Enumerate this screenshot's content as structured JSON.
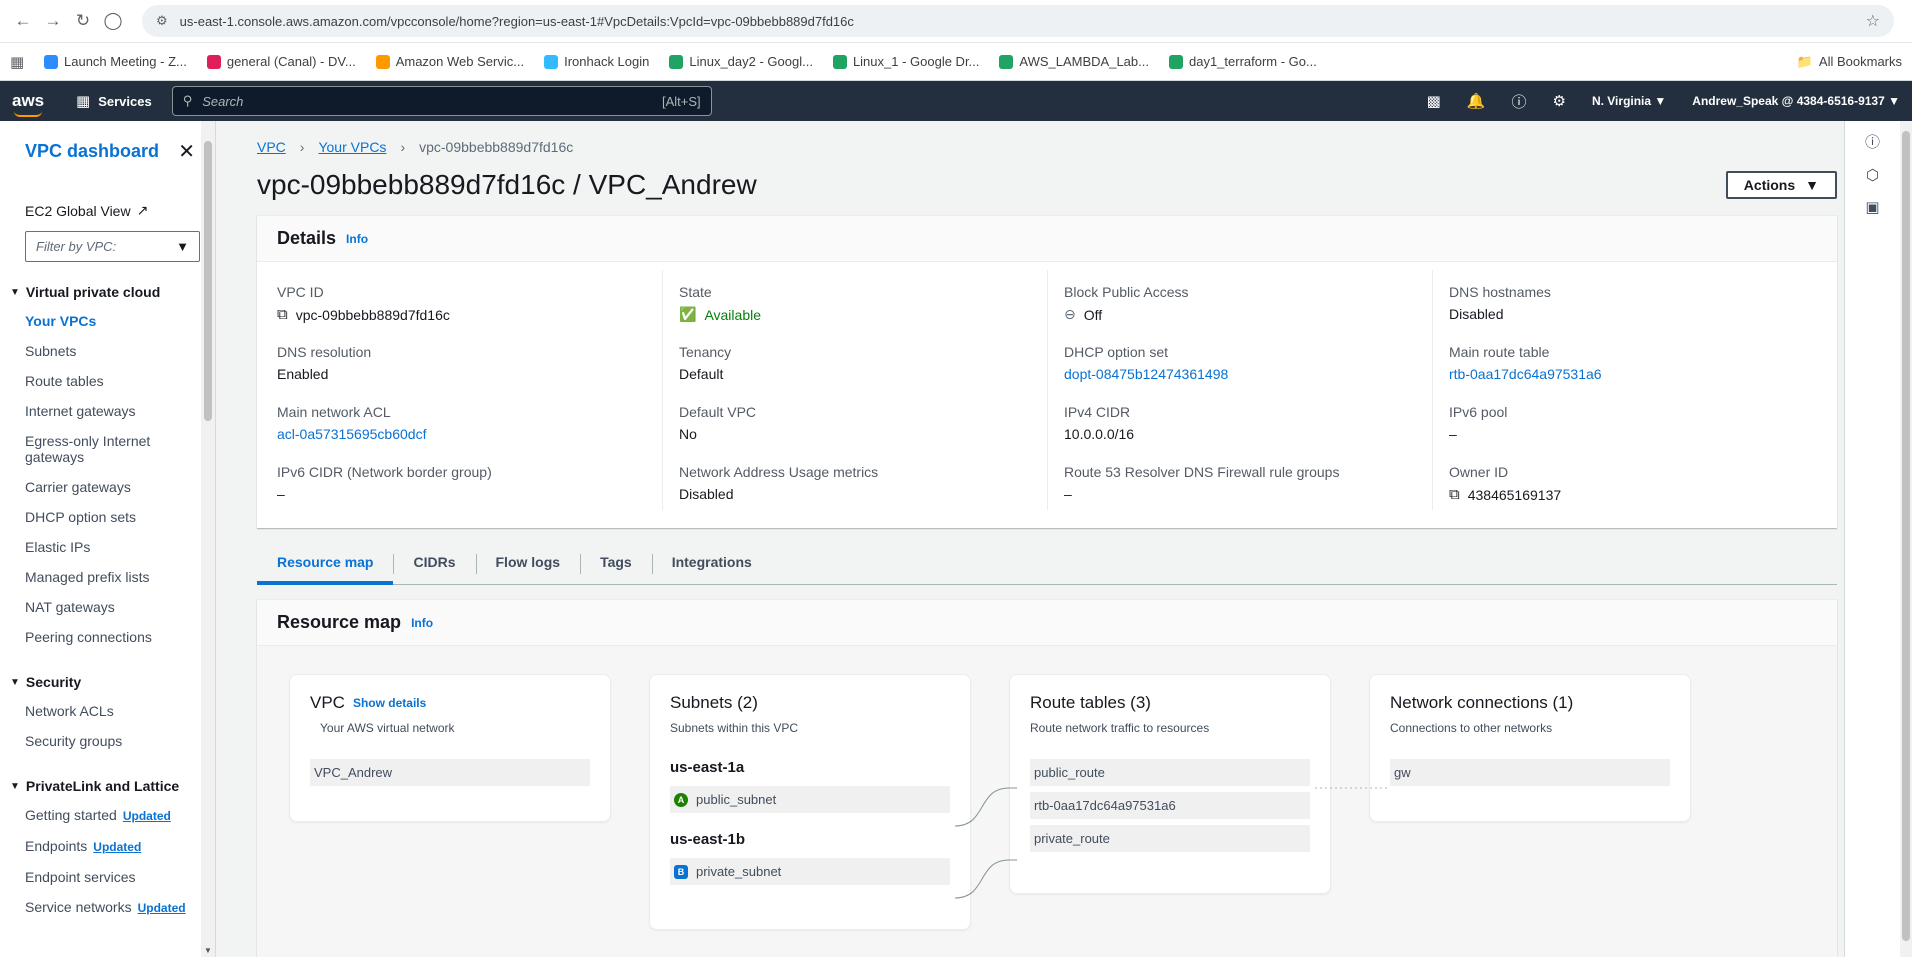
{
  "browser": {
    "url": "us-east-1.console.aws.amazon.com/vpcconsole/home?region=us-east-1#VpcDetails:VpcId=vpc-09bbebb889d7fd16c",
    "bookmarks": [
      {
        "label": "Launch Meeting - Z...",
        "color": "#2d8cff"
      },
      {
        "label": "general (Canal) - DV...",
        "color": "#e01e5a"
      },
      {
        "label": "Amazon Web Servic...",
        "color": "#ff9900"
      },
      {
        "label": "Ironhack Login",
        "color": "#32bcff"
      },
      {
        "label": "Linux_day2 - Googl...",
        "color": "#1fa463"
      },
      {
        "label": "Linux_1 - Google Dr...",
        "color": "#1fa463"
      },
      {
        "label": "AWS_LAMBDA_Lab...",
        "color": "#1fa463"
      },
      {
        "label": "day1_terraform - Go...",
        "color": "#1fa463"
      }
    ],
    "all_bookmarks": "All Bookmarks"
  },
  "aws_nav": {
    "logo": "aws",
    "services": "Services",
    "search_placeholder": "Search",
    "search_shortcut": "[Alt+S]",
    "region": "N. Virginia",
    "account": "Andrew_Speak @ 4384-6516-9137"
  },
  "sidebar": {
    "title": "VPC dashboard",
    "ec2_global_view": "EC2 Global View",
    "filter_placeholder": "Filter by VPC:",
    "sections": [
      {
        "title": "Virtual private cloud",
        "items": [
          {
            "label": "Your VPCs",
            "active": true
          },
          {
            "label": "Subnets"
          },
          {
            "label": "Route tables"
          },
          {
            "label": "Internet gateways"
          },
          {
            "label": "Egress-only Internet gateways"
          },
          {
            "label": "Carrier gateways"
          },
          {
            "label": "DHCP option sets"
          },
          {
            "label": "Elastic IPs"
          },
          {
            "label": "Managed prefix lists"
          },
          {
            "label": "NAT gateways"
          },
          {
            "label": "Peering connections"
          }
        ]
      },
      {
        "title": "Security",
        "items": [
          {
            "label": "Network ACLs"
          },
          {
            "label": "Security groups"
          }
        ]
      },
      {
        "title": "PrivateLink and Lattice",
        "items": [
          {
            "label": "Getting started",
            "badge": "Updated"
          },
          {
            "label": "Endpoints",
            "badge": "Updated"
          },
          {
            "label": "Endpoint services"
          },
          {
            "label": "Service networks",
            "badge": "Updated"
          }
        ]
      }
    ]
  },
  "breadcrumb": [
    "VPC",
    "Your VPCs",
    "vpc-09bbebb889d7fd16c"
  ],
  "page_title": "vpc-09bbebb889d7fd16c / VPC_Andrew",
  "actions_label": "Actions",
  "details": {
    "heading": "Details",
    "info": "Info",
    "columns": [
      [
        {
          "label": "VPC ID",
          "value": "vpc-09bbebb889d7fd16c",
          "copy": true
        },
        {
          "label": "DNS resolution",
          "value": "Enabled"
        },
        {
          "label": "Main network ACL",
          "value": "acl-0a57315695cb60dcf",
          "link": true
        },
        {
          "label": "IPv6 CIDR (Network border group)",
          "value": "–"
        }
      ],
      [
        {
          "label": "State",
          "value": "Available",
          "status": "ok"
        },
        {
          "label": "Tenancy",
          "value": "Default"
        },
        {
          "label": "Default VPC",
          "value": "No"
        },
        {
          "label": "Network Address Usage metrics",
          "value": "Disabled"
        }
      ],
      [
        {
          "label": "Block Public Access",
          "value": "Off",
          "status": "off"
        },
        {
          "label": "DHCP option set",
          "value": "dopt-08475b12474361498",
          "link": true
        },
        {
          "label": "IPv4 CIDR",
          "value": "10.0.0.0/16"
        },
        {
          "label": "Route 53 Resolver DNS Firewall rule groups",
          "value": "–"
        }
      ],
      [
        {
          "label": "DNS hostnames",
          "value": "Disabled"
        },
        {
          "label": "Main route table",
          "value": "rtb-0aa17dc64a97531a6",
          "link": true
        },
        {
          "label": "IPv6 pool",
          "value": "–"
        },
        {
          "label": "Owner ID",
          "value": "438465169137",
          "copy": true
        }
      ]
    ]
  },
  "tabs": [
    "Resource map",
    "CIDRs",
    "Flow logs",
    "Tags",
    "Integrations"
  ],
  "resource_map": {
    "heading": "Resource map",
    "info": "Info",
    "vpc": {
      "title": "VPC",
      "show_details": "Show details",
      "subtitle": "Your AWS virtual network",
      "name": "VPC_Andrew"
    },
    "subnets": {
      "title": "Subnets (2)",
      "subtitle": "Subnets within this VPC",
      "zones": [
        {
          "az": "us-east-1a",
          "badge": "A",
          "subnet": "public_subnet"
        },
        {
          "az": "us-east-1b",
          "badge": "B",
          "subnet": "private_subnet"
        }
      ]
    },
    "route_tables": {
      "title": "Route tables (3)",
      "subtitle": "Route network traffic to resources",
      "items": [
        "public_route",
        "rtb-0aa17dc64a97531a6",
        "private_route"
      ]
    },
    "network_connections": {
      "title": "Network connections (1)",
      "subtitle": "Connections to other networks",
      "items": [
        "gw"
      ]
    }
  }
}
